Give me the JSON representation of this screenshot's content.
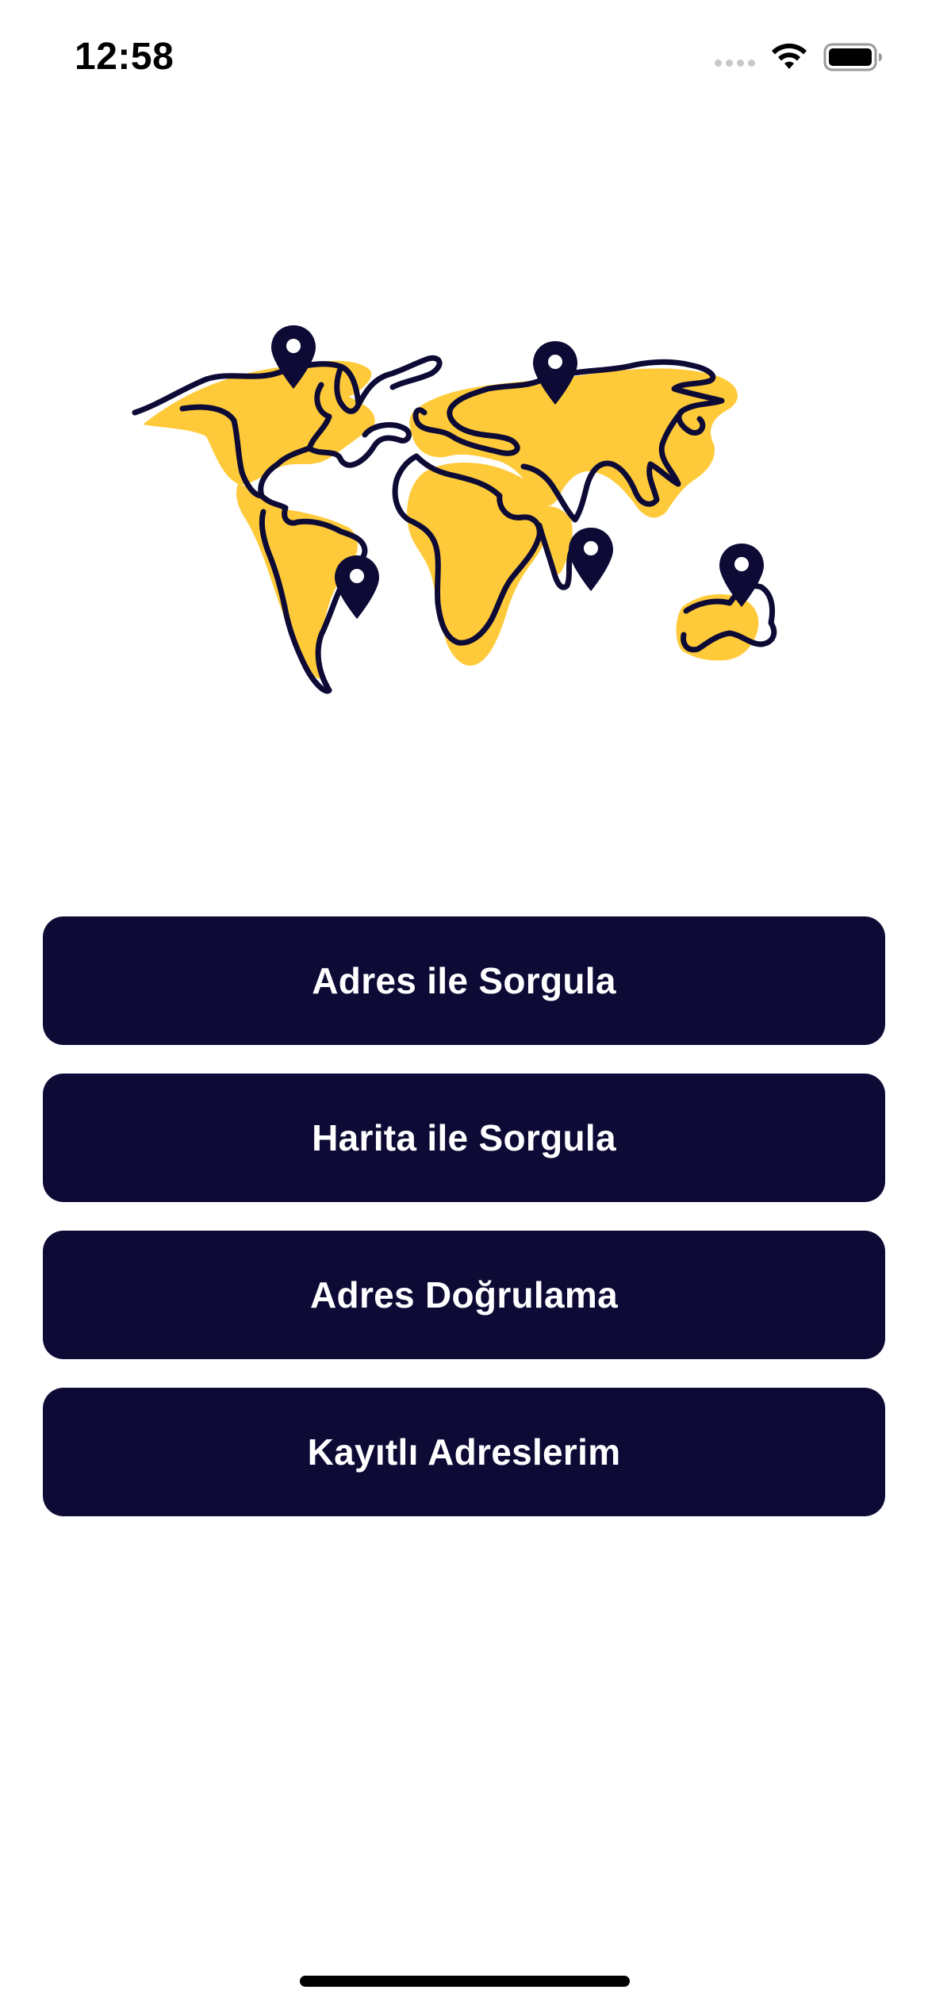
{
  "status_bar": {
    "time": "12:58",
    "wifi_icon": "wifi-icon",
    "battery_icon": "battery-icon"
  },
  "illustration": {
    "icon": "world-map-illustration",
    "colors": {
      "land": "#FFCA3A",
      "outline": "#0D0A36"
    }
  },
  "menu": {
    "items": [
      {
        "label": "Adres ile Sorgula"
      },
      {
        "label": "Harita ile Sorgula"
      },
      {
        "label": "Adres Doğrulama"
      },
      {
        "label": "Kayıtlı Adreslerim"
      }
    ]
  },
  "colors": {
    "button_bg": "#0D0A36",
    "button_text": "#FFFFFF",
    "background": "#FFFFFF"
  }
}
